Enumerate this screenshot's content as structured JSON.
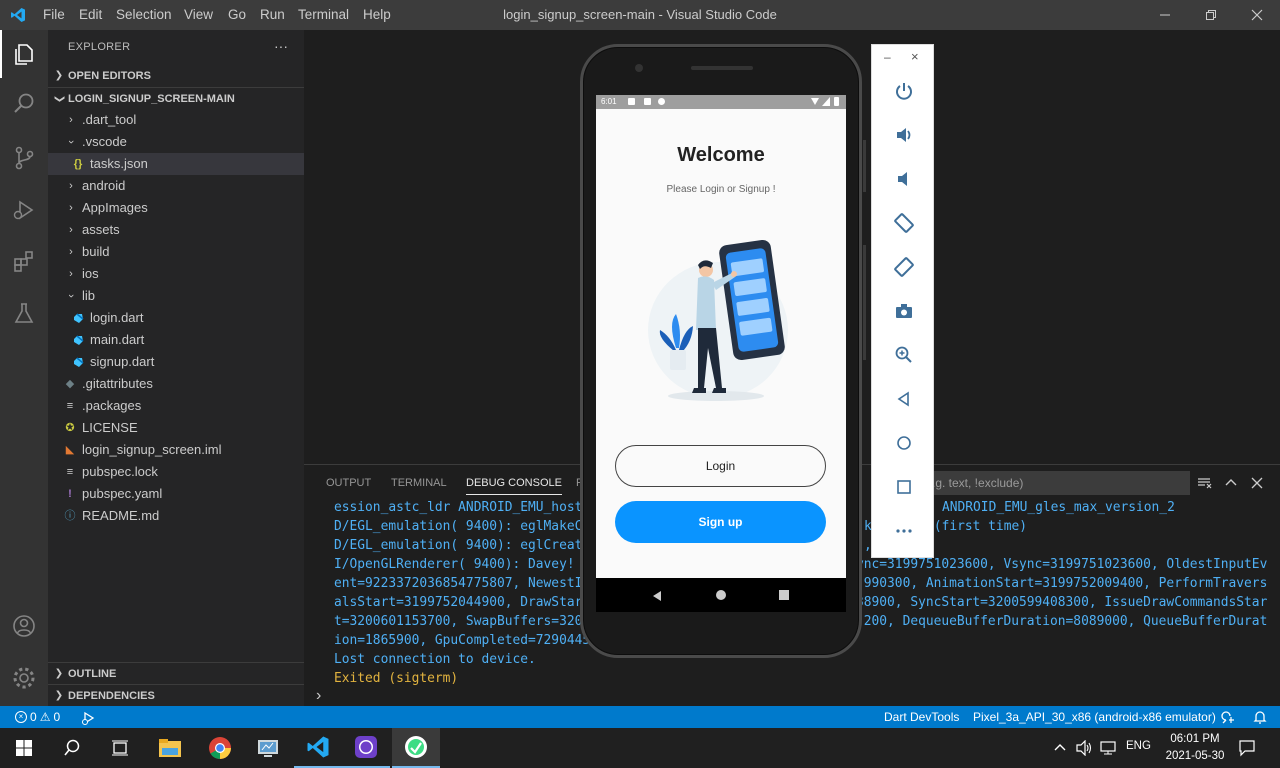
{
  "window": {
    "title": "login_signup_screen-main - Visual Studio Code",
    "menu": [
      "File",
      "Edit",
      "Selection",
      "View",
      "Go",
      "Run",
      "Terminal",
      "Help"
    ]
  },
  "sidebar": {
    "header": "EXPLORER",
    "more": "···",
    "open_editors": "OPEN EDITORS",
    "root": "LOGIN_SIGNUP_SCREEN-MAIN",
    "items": [
      {
        "label": ".dart_tool",
        "icon": "chevron-right-icon"
      },
      {
        "label": ".vscode",
        "icon": "chevron-down-icon"
      },
      {
        "label": "tasks.json",
        "icon": "json-braces-icon"
      },
      {
        "label": "android",
        "icon": "chevron-right-icon"
      },
      {
        "label": "AppImages",
        "icon": "chevron-right-icon"
      },
      {
        "label": "assets",
        "icon": "chevron-right-icon"
      },
      {
        "label": "build",
        "icon": "chevron-right-icon"
      },
      {
        "label": "ios",
        "icon": "chevron-right-icon"
      },
      {
        "label": "lib",
        "icon": "chevron-down-icon"
      },
      {
        "label": "login.dart",
        "icon": "dart-file-icon"
      },
      {
        "label": "main.dart",
        "icon": "dart-file-icon"
      },
      {
        "label": "signup.dart",
        "icon": "dart-file-icon"
      },
      {
        "label": ".gitattributes",
        "icon": "git-file-icon"
      },
      {
        "label": ".packages",
        "icon": "lines-file-icon"
      },
      {
        "label": "LICENSE",
        "icon": "license-file-icon"
      },
      {
        "label": "login_signup_screen.iml",
        "icon": "rss-file-icon"
      },
      {
        "label": "pubspec.lock",
        "icon": "lines-file-icon"
      },
      {
        "label": "pubspec.yaml",
        "icon": "yaml-file-icon"
      },
      {
        "label": "README.md",
        "icon": "info-file-icon"
      }
    ],
    "outline": "OUTLINE",
    "dependencies": "DEPENDENCIES"
  },
  "panel": {
    "tabs": [
      "OUTPUT",
      "TERMINAL",
      "DEBUG CONSOLE",
      "P"
    ],
    "filter_placeholder": ".g. text, !exclude)",
    "lines": [
      "ession_astc_ldr ANDROID_EMU_host",
      "D/EGL_emulation( 9400): eglMakeC",
      "D/EGL_emulation( 9400): eglCreat",
      "I/OpenGLRenderer( 9400): Davey!",
      "ent=9223372036854775807, NewestI",
      "alsStart=3199752044900, DrawStar",
      "t=3200601153700, SwapBuffers=320",
      "ion=1865900, GpuCompleted=7290445",
      "Lost connection to device."
    ],
    "lines_right": [
      "ANDROID_EMU_gles_max_version_2",
      "ke       (first time)",
      ",",
      "ync=3199751023600, Vsync=3199751023600, OldestInputEv",
      ".990300, AnimationStart=3199752009400, PerformTravers",
      "38900, SyncStart=3200599408300, IssueDrawCommandsStar",
      ".200, DequeueBufferDuration=8089000, QueueBufferDurat",
      "",
      ""
    ],
    "exited": "Exited (sigterm)",
    "prompt": "›"
  },
  "statusbar": {
    "errors": "0",
    "warnings": "0",
    "devtools": "Dart DevTools",
    "device": "Pixel_3a_API_30_x86 (android-x86 emulator)"
  },
  "phone": {
    "time": "6:01",
    "welcome": "Welcome",
    "subtitle": "Please Login or Signup !",
    "login": "Login",
    "signup": "Sign up"
  },
  "taskbar": {
    "lang": "ENG",
    "time": "06:01 PM",
    "date": "2021-05-30"
  },
  "colors": {
    "accent": "#007acc",
    "signup_button": "#0a94ff",
    "console_text": "#4fb0f5",
    "exited_text": "#e2b33f"
  }
}
